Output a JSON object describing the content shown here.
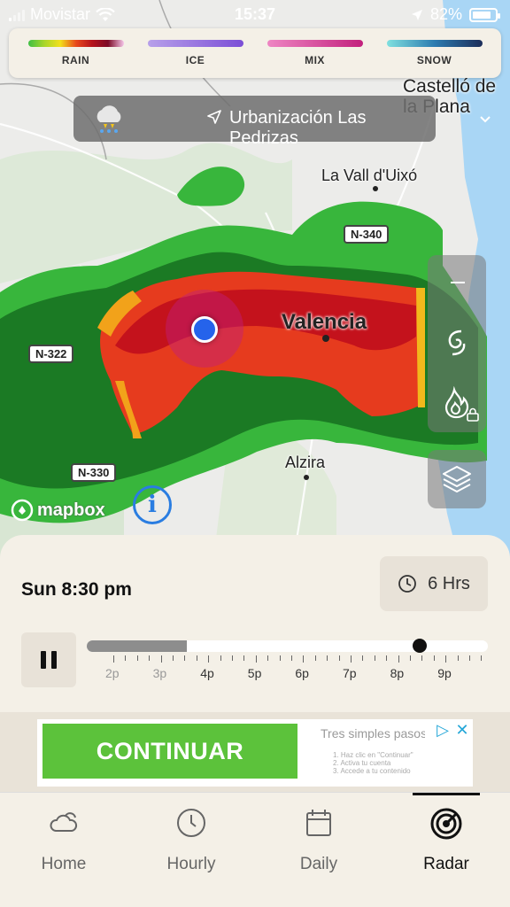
{
  "status_bar": {
    "carrier": "Movistar",
    "time": "15:37",
    "battery": "82%"
  },
  "legend": [
    {
      "label": "RAIN",
      "gradient": "linear-gradient(90deg,#3fbf45,#a8d62a,#f2e01c,#e8491c,#b5121b,#7c0a26,#f5c6e9)"
    },
    {
      "label": "ICE",
      "gradient": "linear-gradient(90deg,#b7a0ea,#7b4ed6)"
    },
    {
      "label": "MIX",
      "gradient": "linear-gradient(90deg,#ee86c3,#c2207d)"
    },
    {
      "label": "SNOW",
      "gradient": "linear-gradient(90deg,#7fe0df,#2c7bb0,#1c2d59)"
    }
  ],
  "location": {
    "name": "Urbanización Las Pedrizas"
  },
  "map": {
    "places": [
      {
        "key": "castello",
        "text": "Castelló de la Plana"
      },
      {
        "key": "vall",
        "text": "La Vall d'Uixó"
      },
      {
        "key": "valencia",
        "text": "Valencia"
      },
      {
        "key": "alzira",
        "text": "Alzira"
      }
    ],
    "roads": [
      "N-340",
      "N-322",
      "N-330"
    ],
    "attribution": "mapbox"
  },
  "timeline": {
    "current": "Sun 8:30 pm",
    "range_label": "6 Hrs",
    "ticks": [
      "2p",
      "3p",
      "4p",
      "5p",
      "6p",
      "7p",
      "8p",
      "9p"
    ],
    "progress": 0.25,
    "position": 0.83
  },
  "ad": {
    "button": "CONTINUAR",
    "title": "Tres simples pasos",
    "steps": [
      "1. Haz clic en \"Continuar\"",
      "2. Activa tu cuenta",
      "3. Accede a tu contenido"
    ]
  },
  "tabs": [
    {
      "key": "home",
      "label": "Home",
      "active": false
    },
    {
      "key": "hourly",
      "label": "Hourly",
      "active": false
    },
    {
      "key": "daily",
      "label": "Daily",
      "active": false
    },
    {
      "key": "radar",
      "label": "Radar",
      "active": true
    }
  ]
}
